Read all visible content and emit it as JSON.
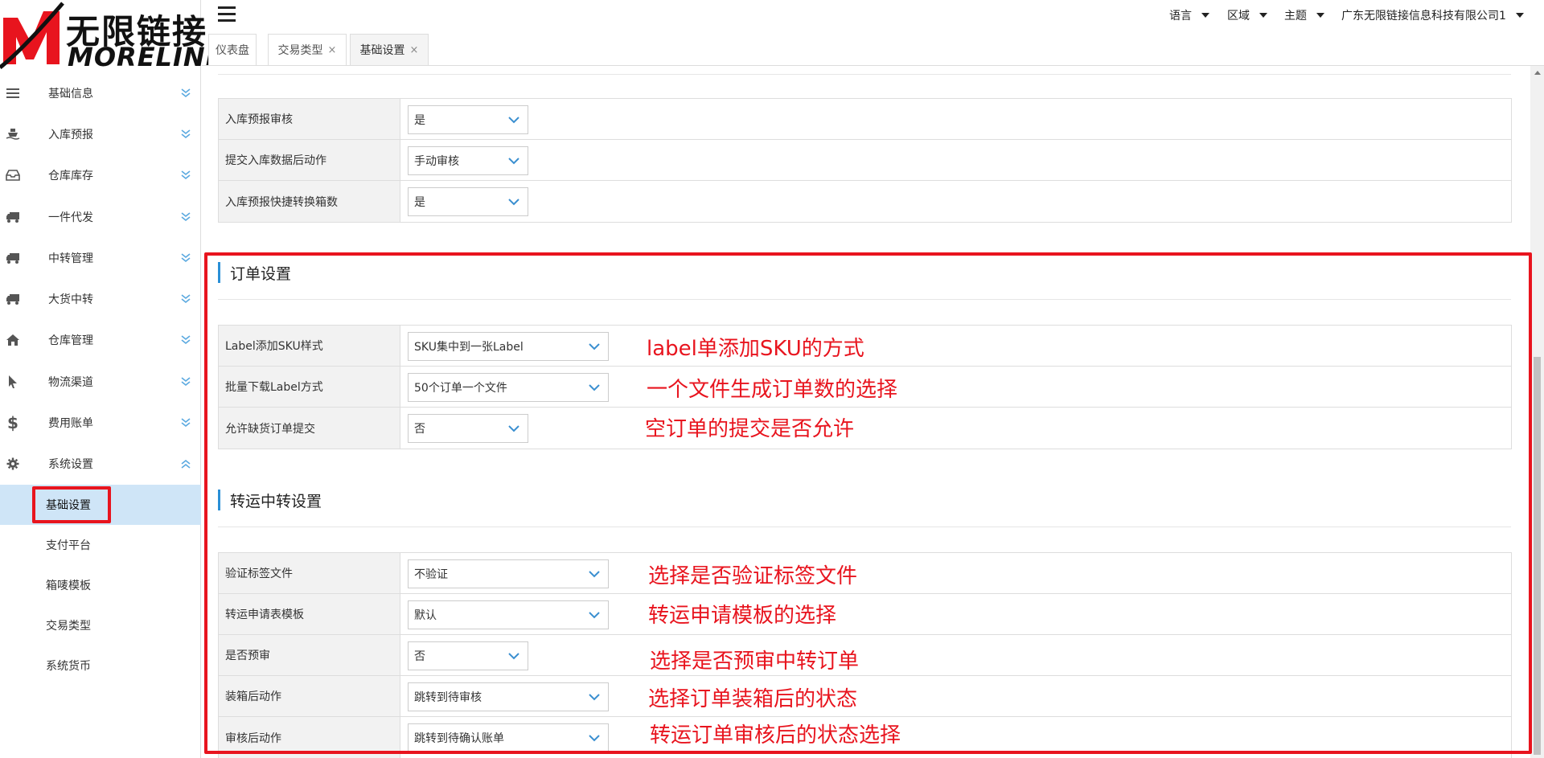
{
  "logo": {
    "cn": "无限链接",
    "en": "MORELINK",
    "brand_color": "#e8141e"
  },
  "sidebar": {
    "items": [
      {
        "label": "基础信息",
        "icon": "list-icon"
      },
      {
        "label": "入库预报",
        "icon": "ship-icon"
      },
      {
        "label": "仓库库存",
        "icon": "inbox-icon"
      },
      {
        "label": "一件代发",
        "icon": "truck-icon"
      },
      {
        "label": "中转管理",
        "icon": "truck-icon"
      },
      {
        "label": "大货中转",
        "icon": "truck-icon"
      },
      {
        "label": "仓库管理",
        "icon": "home-icon"
      },
      {
        "label": "物流渠道",
        "icon": "pointer-icon"
      },
      {
        "label": "费用账单",
        "icon": "dollar-icon"
      },
      {
        "label": "系统设置",
        "icon": "gear-icon"
      }
    ],
    "sub_items": [
      "基础设置",
      "支付平台",
      "箱唛模板",
      "交易类型",
      "系统货币"
    ],
    "active_sub": "基础设置"
  },
  "header": {
    "language": "语言",
    "region": "区域",
    "theme": "主题",
    "company": "广东无限链接信息科技有限公司1"
  },
  "tabs": [
    {
      "label": "仪表盘",
      "closable": false
    },
    {
      "label": "交易类型",
      "closable": true,
      "close": "×"
    },
    {
      "label": "基础设置",
      "closable": true,
      "close": "×",
      "active": true
    }
  ],
  "inbound": {
    "rows": [
      {
        "label": "入库预报审核",
        "value": "是"
      },
      {
        "label": "提交入库数据后动作",
        "value": "手动审核"
      },
      {
        "label": "入库预报快捷转换箱数",
        "value": "是"
      }
    ]
  },
  "order_settings": {
    "title": "订单设置",
    "rows": [
      {
        "label": "Label添加SKU样式",
        "value": "SKU集中到一张Label",
        "note": "label单添加SKU的方式"
      },
      {
        "label": "批量下载Label方式",
        "value": "50个订单一个文件",
        "note": "一个文件生成订单数的选择"
      },
      {
        "label": "允许缺货订单提交",
        "value": "否",
        "note": "空订单的提交是否允许"
      }
    ]
  },
  "transfer_settings": {
    "title": "转运中转设置",
    "rows": [
      {
        "label": "验证标签文件",
        "value": "不验证",
        "note": "选择是否验证标签文件"
      },
      {
        "label": "转运申请表模板",
        "value": "默认",
        "note": "转运申请模板的选择"
      },
      {
        "label": "是否预审",
        "value": "否",
        "note": "选择是否预审中转订单"
      },
      {
        "label": "装箱后动作",
        "value": "跳转到待审核",
        "note": "选择订单装箱后的状态"
      },
      {
        "label": "审核后动作",
        "value": "跳转到待确认账单",
        "note": "转运订单审核后的状态选择"
      }
    ]
  },
  "colors": {
    "annotation": "#e8141e",
    "accent": "#2a8fd6",
    "active_bg": "#cfe5f7"
  }
}
